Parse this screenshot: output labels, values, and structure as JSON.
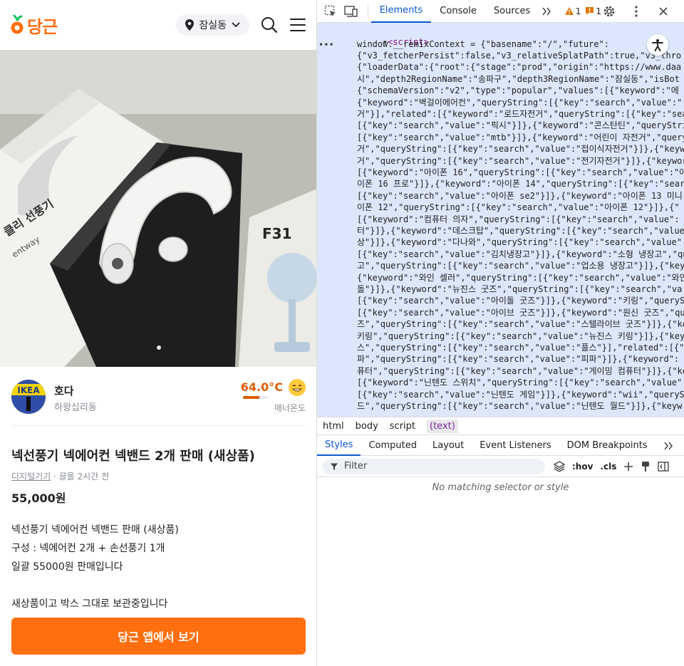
{
  "app": {
    "logo_text": "당근",
    "location": "잠실동",
    "brand_color": "#ff6f0f"
  },
  "product": {
    "image_dot_count": 1,
    "seller": {
      "name": "호다",
      "area": "하왕십리동",
      "avatar_text": "IKEA",
      "temperature": "64.0°C",
      "temperature_ratio": 0.64,
      "manner_label": "매너온도"
    },
    "title": "넥선풍기 넥에어컨 넥밴드 2개 판매 (새상품)",
    "category": "디지털기기",
    "meta_rest": " · 끌올 2시간 전",
    "price": "55,000원",
    "description": [
      "넥선풍기 넥에어컨 넥밴드 판매 (새상품)",
      "구성 : 넥에어컨 2개 + 손선풍기 1개",
      "일괄 55000원 판매입니다",
      "",
      "새상품이고 박스 그대로 보관중입니다"
    ],
    "cta_label": "당근 앱에서 보기",
    "box_text": {
      "fan_label": "클리 선풍기",
      "fan_sub": "entway",
      "f31": "F31"
    }
  },
  "devtools": {
    "tabs": [
      "Elements",
      "Console",
      "Sources"
    ],
    "active_tab": "Elements",
    "warnings": "1",
    "issues": "1",
    "script_tag": "<script>",
    "code_lines": [
      "window.__remixContext = {\"basename\":\"/\",\"future\":",
      "{\"v3_fetcherPersist\":false,\"v3_relativeSplatPath\":true,\"v3_thro",
      "{\"loaderData\":{\"root\":{\"stage\":\"prod\",\"origin\":\"https://www.daa",
      "시\",\"depth2RegionName\":\"송파구\",\"depth3RegionName\":\"잠실동\",\"isBot",
      "{\"schemaVersion\":\"v2\",\"type\":\"popular\",\"values\":[{\"keyword\":\"에",
      "{\"keyword\":\"벽걸이에어컨\",\"queryString\":[{\"key\":\"search\",\"value\":\"",
      "거\"}],\"related\":[{\"keyword\":\"로드자전거\",\"queryString\":[{\"key\":\"sea",
      "[{\"key\":\"search\",\"value\":\"픽시\"}]},{\"keyword\":\"콘스탄틴\",\"queryStri",
      "[{\"key\":\"search\",\"value\":\"mtb\"}]},{\"keyword\":\"어린이 자전거\",\"query",
      "거\",\"queryString\":[{\"key\":\"search\",\"value\":\"접이식자전거\"}]},{\"keyw",
      "거\",\"queryString\":[{\"key\":\"search\",\"value\":\"전기자전거\"}]},{\"keywor",
      "[{\"keyword\":\"아이폰 16\",\"queryString\":[{\"key\":\"search\",\"value\":\"아",
      "이폰 16 프로\"}]},{\"keyword\":\"아이폰 14\",\"queryString\":[{\"key\":\"sear",
      "[{\"key\":\"search\",\"value\":\"아이폰 se2\"}]},{\"keyword\":\"아이폰 13 미니",
      "이폰 12\",\"queryString\":[{\"key\":\"search\",\"value\":\"아이폰 12\"}]},{\"",
      "[{\"keyword\":\"컴퓨터 의자\",\"queryString\":[{\"key\":\"search\",\"value\":",
      "터\"}]},{\"keyword\":\"데스크탑\",\"queryString\":[{\"key\":\"search\",\"value",
      "상\"}]},{\"keyword\":\"다나와\",\"queryString\":[{\"key\":\"search\",\"value\"",
      "[{\"key\":\"search\",\"value\":\"김치냉장고\"}]},{\"keyword\":\"소형 냉장고\",\"qu",
      "고\",\"queryString\":[{\"key\":\"search\",\"value\":\"업소용 냉장고\"}]},{\"key",
      "{\"keyword\":\"와인 셀러\",\"queryString\":[{\"key\":\"search\",\"value\":\"와인",
      "돌\"}]},{\"keyword\":\"뉴진스 굿즈\",\"queryString\":[{\"key\":\"search\",\"va",
      "[{\"key\":\"search\",\"value\":\"아이돌 굿즈\"}]},{\"keyword\":\"키링\",\"queryS",
      "[{\"key\":\"search\",\"value\":\"아이브 굿즈\"}]},{\"keyword\":\"원신 굿즈\",\"qu",
      "즈\",\"queryString\":[{\"key\":\"search\",\"value\":\"스텔라이브 굿즈\"}]},{\"ke",
      "키링\",\"queryString\":[{\"key\":\"search\",\"value\":\"뉴진스 키링\"}]},{\"key",
      "스\",\"queryString\":[{\"key\":\"search\",\"value\":\"플스\"}],\"related\":[{\"",
      "파\",\"queryString\":[{\"key\":\"search\",\"value\":\"피파\"}]},{\"keyword\":",
      "퓨터\",\"queryString\":[{\"key\":\"search\",\"value\":\"게이밍 컴퓨터\"}]},{\"ke",
      "[{\"keyword\":\"닌텐도 스위치\",\"queryString\":[{\"key\":\"search\",\"value\":",
      "[{\"key\":\"search\",\"value\":\"닌텐도 게임\"}]},{\"keyword\":\"wii\",\"queryS",
      "드\",\"queryString\":[{\"key\":\"search\",\"value\":\"닌텐도 월드\"}]},{\"keyw"
    ],
    "breadcrumb": [
      "html",
      "body",
      "script",
      "(text)"
    ],
    "styles_tabs": [
      "Styles",
      "Computed",
      "Layout",
      "Event Listeners",
      "DOM Breakpoints"
    ],
    "filter_placeholder": "Filter",
    "hov_label": ":hov",
    "cls_label": ".cls",
    "no_match_text": "No matching selector or style"
  }
}
